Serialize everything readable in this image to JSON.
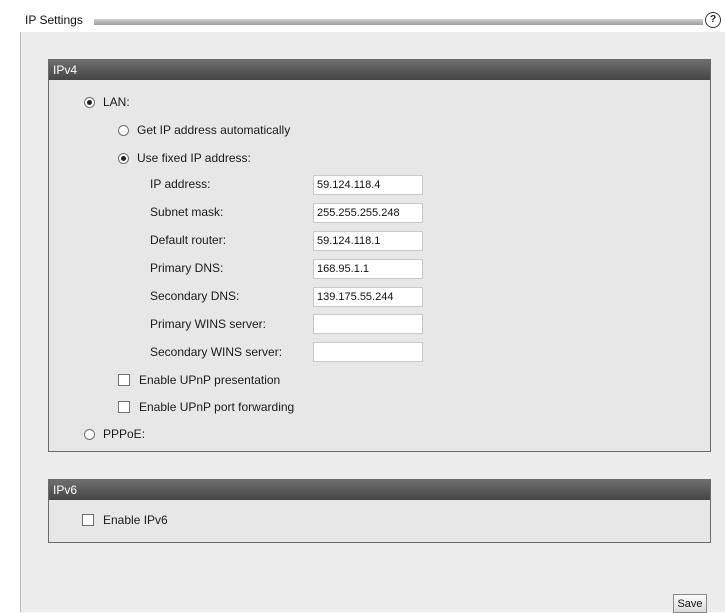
{
  "page": {
    "title": "IP Settings",
    "help_icon": "?"
  },
  "ipv4": {
    "header": "IPv4",
    "lan_label": "LAN:",
    "lan_selected": true,
    "auto_label": "Get IP address automatically",
    "auto_selected": false,
    "fixed_label": "Use fixed IP address:",
    "fixed_selected": true,
    "fields": {
      "ip_label": "IP address:",
      "ip_value": "59.124.118.4",
      "subnet_label": "Subnet mask:",
      "subnet_value": "255.255.255.248",
      "router_label": "Default router:",
      "router_value": "59.124.118.1",
      "pdns_label": "Primary DNS:",
      "pdns_value": "168.95.1.1",
      "sdns_label": "Secondary DNS:",
      "sdns_value": "139.175.55.244",
      "pwins_label": "Primary WINS server:",
      "pwins_value": "",
      "swins_label": "Secondary WINS server:",
      "swins_value": ""
    },
    "upnp_presentation_label": "Enable UPnP presentation",
    "upnp_presentation_checked": false,
    "upnp_forwarding_label": "Enable UPnP port forwarding",
    "upnp_forwarding_checked": false,
    "pppoe_label": "PPPoE:",
    "pppoe_selected": false
  },
  "ipv6": {
    "header": "IPv6",
    "enable_label": "Enable IPv6",
    "enable_checked": false
  },
  "save_label": "Save"
}
